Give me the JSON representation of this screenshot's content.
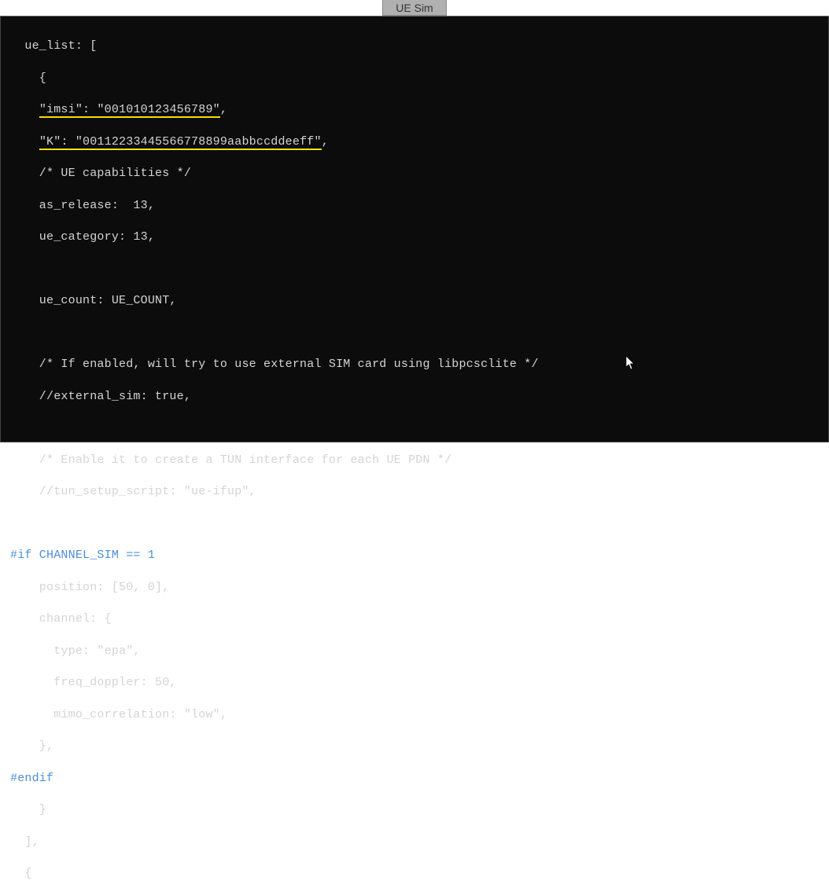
{
  "tab": {
    "label": "UE Sim"
  },
  "code": {
    "l1": "  ue_list: [",
    "l2": "    {",
    "l3_pre": "    ",
    "l3_imsi_key": "\"imsi\"",
    "l3_imsi_sep": ": ",
    "l3_imsi_val": "\"001010123456789\"",
    "l3_trail": ",",
    "l4_pre": "    ",
    "l4_k_key": "\"K\"",
    "l4_k_sep": ": ",
    "l4_k_val": "\"00112233445566778899aabbccddeeff\"",
    "l4_trail": ",",
    "l5": "    /* UE capabilities */",
    "l6": "    as_release:  13,",
    "l7": "    ue_category: 13,",
    "l8": "",
    "l9": "    ue_count: UE_COUNT,",
    "l10": "",
    "l11": "    /* If enabled, will try to use external SIM card using libpcsclite */",
    "l12": "    //external_sim: true,",
    "l13": "",
    "l14": "    /* Enable it to create a TUN interface for each UE PDN */",
    "l15": "    //tun_setup_script: \"ue-ifup\",",
    "l16": "",
    "l17": "#if CHANNEL_SIM == 1",
    "l18": "    position: [50, 0],",
    "l19": "    channel: {",
    "l20": "      type: \"epa\",",
    "l21": "      freq_doppler: 50,",
    "l22": "      mimo_correlation: \"low\",",
    "l23": "    },",
    "l24": "#endif",
    "l25": "    }",
    "l26": "  ],",
    "l27": "  {"
  }
}
